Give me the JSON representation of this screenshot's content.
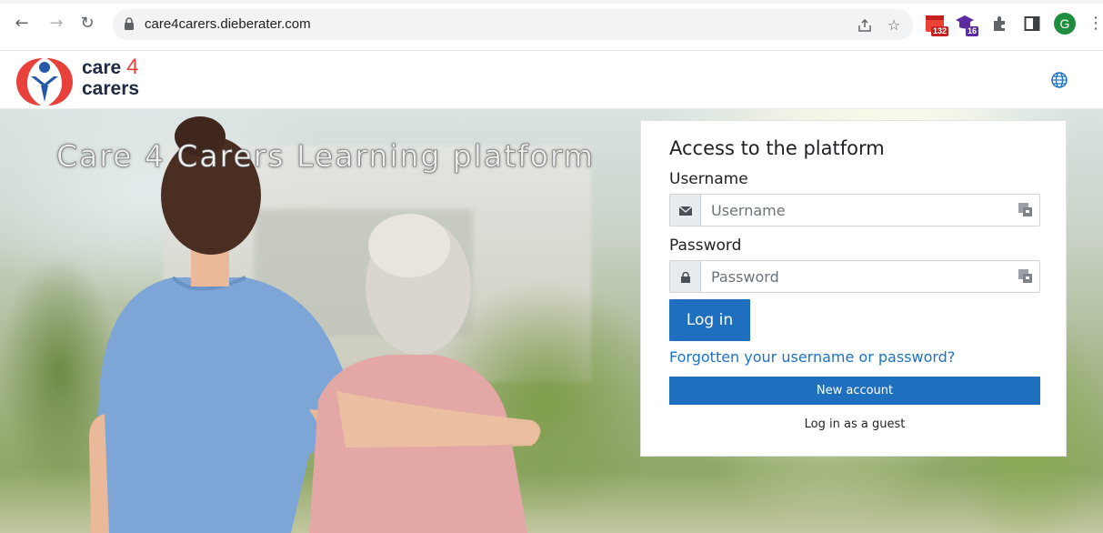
{
  "browser": {
    "url": "care4carers.dieberater.com",
    "extensions": [
      {
        "name": "calendar-extension",
        "badge": "132",
        "badge_color": "#c5221f"
      },
      {
        "name": "graduation-extension",
        "badge": "16",
        "badge_color": "#5a2ca0"
      }
    ],
    "profile_initial": "G",
    "profile_color": "#1e8e3e"
  },
  "site": {
    "logo_line1": "care",
    "logo_four": "4",
    "logo_line2": "carers",
    "colors": {
      "brand_red": "#e8413c",
      "brand_blue": "#2559a8",
      "primary": "#1f6fbf",
      "link": "#1a73c8"
    }
  },
  "hero": {
    "title": "Care 4 Carers Learning platform"
  },
  "login": {
    "heading": "Access to the platform",
    "username_label": "Username",
    "username_placeholder": "Username",
    "password_label": "Password",
    "password_placeholder": "Password",
    "login_button": "Log in",
    "forgot_link": "Forgotten your username or password?",
    "new_account_button": "New account",
    "guest_link": "Log in as a guest"
  }
}
